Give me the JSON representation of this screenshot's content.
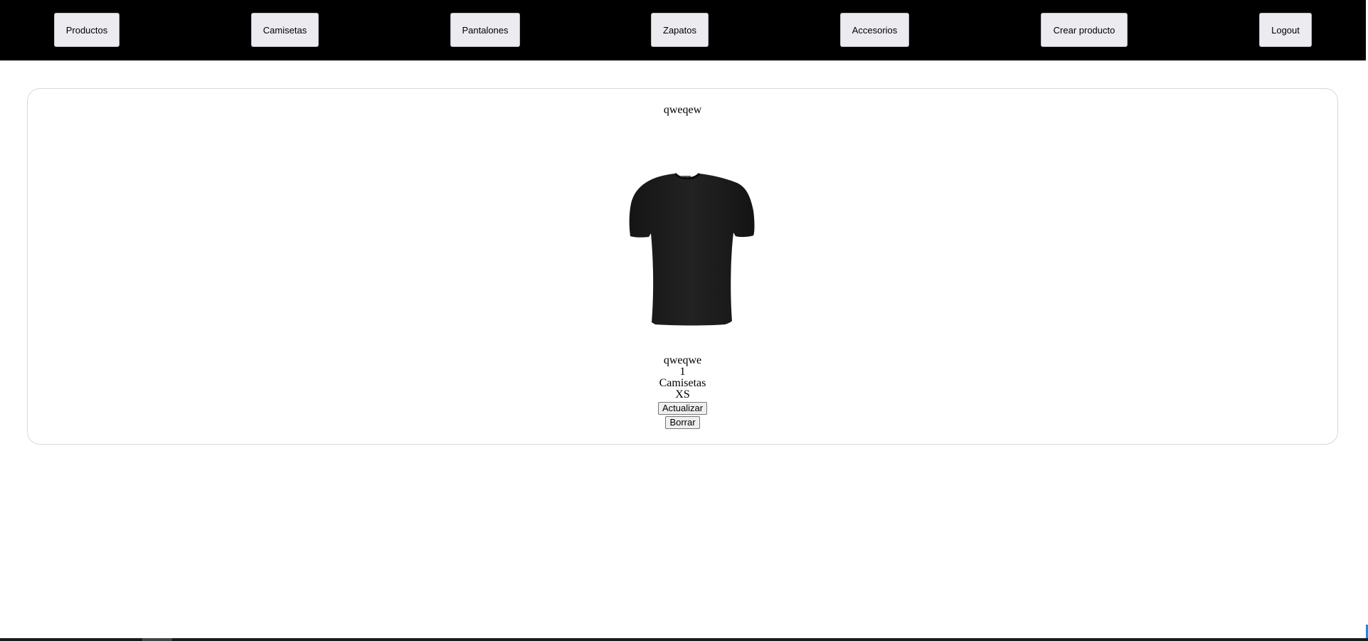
{
  "nav": {
    "productos": "Productos",
    "camisetas": "Camisetas",
    "pantalones": "Pantalones",
    "zapatos": "Zapatos",
    "accesorios": "Accesorios",
    "crear_producto": "Crear producto",
    "logout": "Logout"
  },
  "product": {
    "title": "qweqew",
    "image_icon": "black-tshirt-image",
    "description": "qweqwe",
    "quantity": "1",
    "category": "Camisetas",
    "size": "XS",
    "update_label": "Actualizar",
    "delete_label": "Borrar"
  },
  "colors": {
    "nav_background": "#000000",
    "button_background": "#ecebef"
  }
}
